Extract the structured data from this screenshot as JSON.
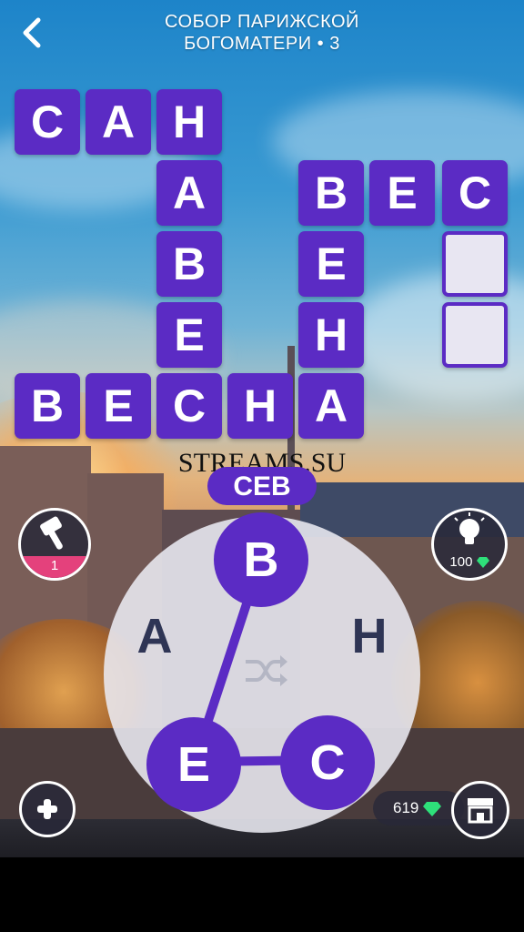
{
  "header": {
    "title_line1": "СОБОР ПАРИЖСКОЙ",
    "title_line2": "БОГОМАТЕРИ • 3"
  },
  "grid": {
    "words": [
      {
        "letters": [
          "С",
          "А",
          "Н"
        ],
        "direction": "across"
      },
      {
        "letters": [
          "Н",
          "А",
          "В",
          "Е",
          "С"
        ],
        "direction": "down"
      },
      {
        "letters": [
          "В",
          "Е",
          "С",
          "Н",
          "А"
        ],
        "direction": "across"
      },
      {
        "letters": [
          "В",
          "Е",
          "Н",
          "А"
        ],
        "direction": "down"
      },
      {
        "letters": [
          "В",
          "Е",
          "С"
        ],
        "direction": "across"
      },
      {
        "letters": [
          "С",
          "",
          ""
        ],
        "direction": "down",
        "solved": false
      }
    ],
    "tiles": [
      "С",
      "А",
      "Н",
      "А",
      "В",
      "Е",
      "В",
      "Е",
      "С",
      "Н",
      "А",
      "В",
      "Е",
      "Н",
      "В",
      "Е",
      "С",
      "",
      ""
    ]
  },
  "watermark": "STREAMS.SU",
  "current_word": "СЕВ",
  "wheel": {
    "letters": [
      "В",
      "Н",
      "С",
      "Е",
      "А"
    ],
    "selected": [
      "С",
      "Е",
      "В"
    ],
    "shuffle_icon": "shuffle-icon"
  },
  "hammer": {
    "icon": "hammer-icon",
    "count": "1"
  },
  "hint": {
    "icon": "lightbulb-icon",
    "cost": "100"
  },
  "coins": {
    "amount": "619",
    "icon": "gem-icon"
  },
  "buttons": {
    "plus_icon": "plus-icon",
    "shop_icon": "shop-icon",
    "back_icon": "chevron-left-icon"
  },
  "colors": {
    "tile": "#5b2bc4",
    "accent_pink": "#e4417c",
    "gem": "#2ee07a"
  }
}
